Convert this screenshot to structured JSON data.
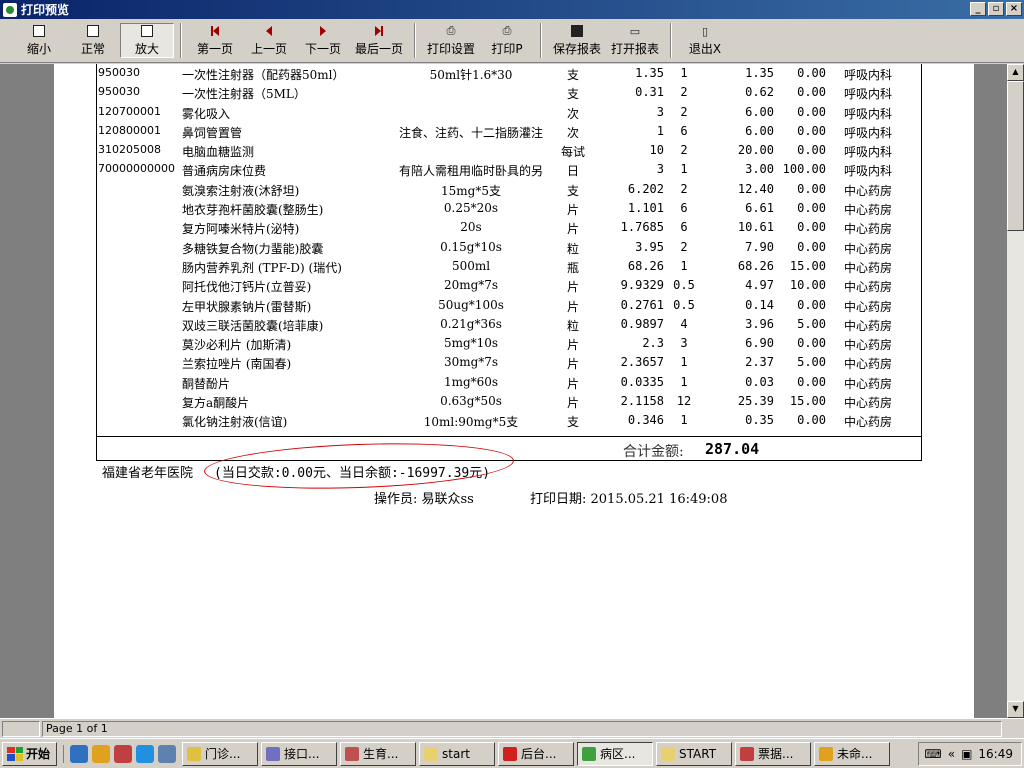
{
  "window": {
    "title": "打印预览",
    "controls": [
      "_",
      "▫",
      "×"
    ]
  },
  "toolbar": {
    "zoom_out": "缩小",
    "normal": "正常",
    "zoom_in": "放大",
    "first_page": "第一页",
    "prev_page": "上一页",
    "next_page": "下一页",
    "last_page": "最后一页",
    "print_setup": "打印设置",
    "print": "打印P",
    "save_report": "保存报表",
    "open_report": "打开报表",
    "exit": "退出X"
  },
  "report": {
    "rows": [
      {
        "code": "950030",
        "name": "一次性注射器（配药器50ml）",
        "spec": "50ml针1.6*30",
        "unit": "支",
        "price": "1.35",
        "qty": "1",
        "amount": "1.35",
        "self_pay": "0.00",
        "dept": "呼吸内科"
      },
      {
        "code": "950030",
        "name": "一次性注射器（5ML）",
        "spec": "",
        "unit": "支",
        "price": "0.31",
        "qty": "2",
        "amount": "0.62",
        "self_pay": "0.00",
        "dept": "呼吸内科"
      },
      {
        "code": "120700001",
        "name": "雾化吸入",
        "spec": "",
        "unit": "次",
        "price": "3",
        "qty": "2",
        "amount": "6.00",
        "self_pay": "0.00",
        "dept": "呼吸内科"
      },
      {
        "code": "120800001",
        "name": "鼻饲管置管",
        "spec": "注食、注药、十二指肠灌注",
        "unit": "次",
        "price": "1",
        "qty": "6",
        "amount": "6.00",
        "self_pay": "0.00",
        "dept": "呼吸内科"
      },
      {
        "code": "310205008",
        "name": "电脑血糖监测",
        "spec": "",
        "unit": "每试",
        "price": "10",
        "qty": "2",
        "amount": "20.00",
        "self_pay": "0.00",
        "dept": "呼吸内科"
      },
      {
        "code": "70000000000",
        "name": "普通病房床位费",
        "spec": "有陪人需租用临时卧具的另",
        "unit": "日",
        "price": "3",
        "qty": "1",
        "amount": "3.00",
        "self_pay": "100.00",
        "dept": "呼吸内科"
      },
      {
        "code": "",
        "name": "氨溴索注射液(沐舒坦)",
        "spec": "15mg*5支",
        "unit": "支",
        "price": "6.202",
        "qty": "2",
        "amount": "12.40",
        "self_pay": "0.00",
        "dept": "中心药房"
      },
      {
        "code": "",
        "name": "地衣芽孢杆菌胶囊(整肠生)",
        "spec": "0.25*20s",
        "unit": "片",
        "price": "1.101",
        "qty": "6",
        "amount": "6.61",
        "self_pay": "0.00",
        "dept": "中心药房"
      },
      {
        "code": "",
        "name": "复方阿嗪米特片(泌特)",
        "spec": "20s",
        "unit": "片",
        "price": "1.7685",
        "qty": "6",
        "amount": "10.61",
        "self_pay": "0.00",
        "dept": "中心药房"
      },
      {
        "code": "",
        "name": "多糖铁复合物(力蜚能)胶囊",
        "spec": "0.15g*10s",
        "unit": "粒",
        "price": "3.95",
        "qty": "2",
        "amount": "7.90",
        "self_pay": "0.00",
        "dept": "中心药房"
      },
      {
        "code": "",
        "name": "肠内营养乳剂 (TPF-D) (瑞代)",
        "spec": "500ml",
        "unit": "瓶",
        "price": "68.26",
        "qty": "1",
        "amount": "68.26",
        "self_pay": "15.00",
        "dept": "中心药房"
      },
      {
        "code": "",
        "name": "阿托伐他汀钙片(立普妥)",
        "spec": "20mg*7s",
        "unit": "片",
        "price": "9.9329",
        "qty": "0.5",
        "amount": "4.97",
        "self_pay": "10.00",
        "dept": "中心药房"
      },
      {
        "code": "",
        "name": "左甲状腺素钠片(雷替斯)",
        "spec": "50ug*100s",
        "unit": "片",
        "price": "0.2761",
        "qty": "0.5",
        "amount": "0.14",
        "self_pay": "0.00",
        "dept": "中心药房"
      },
      {
        "code": "",
        "name": "双歧三联活菌胶囊(培菲康)",
        "spec": "0.21g*36s",
        "unit": "粒",
        "price": "0.9897",
        "qty": "4",
        "amount": "3.96",
        "self_pay": "5.00",
        "dept": "中心药房"
      },
      {
        "code": "",
        "name": "莫沙必利片 (加斯清)",
        "spec": "5mg*10s",
        "unit": "片",
        "price": "2.3",
        "qty": "3",
        "amount": "6.90",
        "self_pay": "0.00",
        "dept": "中心药房"
      },
      {
        "code": "",
        "name": "兰索拉唑片 (南国春)",
        "spec": "30mg*7s",
        "unit": "片",
        "price": "2.3657",
        "qty": "1",
        "amount": "2.37",
        "self_pay": "5.00",
        "dept": "中心药房"
      },
      {
        "code": "",
        "name": "酮替酚片",
        "spec": "1mg*60s",
        "unit": "片",
        "price": "0.0335",
        "qty": "1",
        "amount": "0.03",
        "self_pay": "0.00",
        "dept": "中心药房"
      },
      {
        "code": "",
        "name": "复方a酮酸片",
        "spec": "0.63g*50s",
        "unit": "片",
        "price": "2.1158",
        "qty": "12",
        "amount": "25.39",
        "self_pay": "15.00",
        "dept": "中心药房"
      },
      {
        "code": "",
        "name": "氯化钠注射液(信谊)",
        "spec": "10ml:90mg*5支",
        "unit": "支",
        "price": "0.346",
        "qty": "1",
        "amount": "0.35",
        "self_pay": "0.00",
        "dept": "中心药房"
      }
    ],
    "total_label": "合计金额:",
    "total_value": "287.04",
    "hospital": "福建省老年医院",
    "day_note": "(当日交款:0.00元、当日余额:-16997.39元)",
    "operator": "操作员: 易联众ss",
    "print_date": "打印日期: 2015.05.21 16:49:08"
  },
  "status": {
    "page": "Page 1 of 1"
  },
  "taskbar": {
    "start": "开始",
    "tasks": [
      "门诊...",
      "接口...",
      "生育...",
      "start",
      "后台...",
      "病区...",
      "START",
      "票据...",
      "未命..."
    ],
    "clock": "16:49"
  },
  "colors": {
    "title_bar": "#0a246a",
    "annotation_oval": "#d00000",
    "preview_bg": "#7f7f7f"
  }
}
